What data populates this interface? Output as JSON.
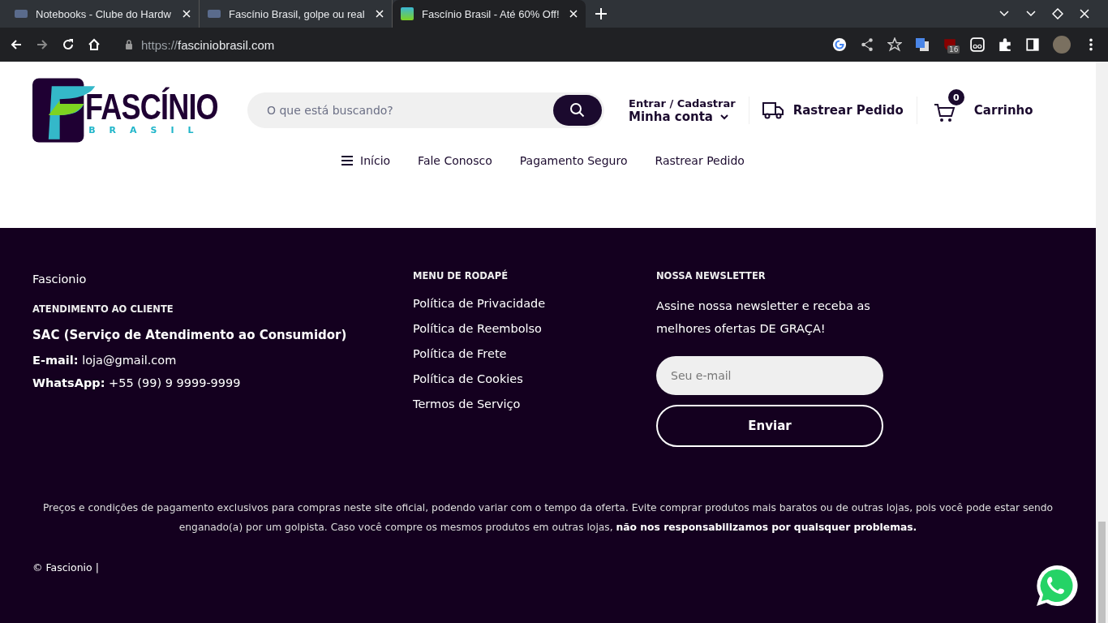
{
  "browser": {
    "tabs": [
      {
        "title": "Notebooks - Clube do Hardw",
        "selected": false
      },
      {
        "title": "Fascínio Brasil, golpe ou real",
        "selected": false
      },
      {
        "title": "Fascínio Brasil - Até 60% Off!",
        "selected": true
      }
    ],
    "url": {
      "scheme": "https://",
      "host": "fasciniobrasil.com"
    },
    "extension_badge": "16"
  },
  "header": {
    "logo": {
      "name": "FASCÍNIO",
      "sub": "BRASIL"
    },
    "search": {
      "placeholder": "O que está buscando?"
    },
    "account": {
      "top": "Entrar / Cadastrar",
      "bottom": "Minha conta"
    },
    "track": "Rastrear Pedido",
    "cart": {
      "count": "0",
      "label": "Carrinho"
    },
    "nav": [
      {
        "label": "Início",
        "kind": "menu"
      },
      {
        "label": "Fale Conosco",
        "kind": "link"
      },
      {
        "label": "Pagamento Seguro",
        "kind": "link"
      },
      {
        "label": "Rastrear Pedido",
        "kind": "link"
      }
    ]
  },
  "footer": {
    "brand": "Fascionio",
    "support_heading": "ATENDIMENTO AO CLIENTE",
    "sac": "SAC (Serviço de Atendimento ao Consumidor)",
    "contacts": [
      {
        "label": "E-mail:",
        "value": "loja@gmail.com"
      },
      {
        "label": "WhatsApp:",
        "value": "+55 (99) 9 9999-9999"
      }
    ],
    "menu_heading": "MENU DE RODAPÉ",
    "links": [
      "Política de Privacidade",
      "Política de Reembolso",
      "Política de Frete",
      "Política de Cookies",
      "Termos de Serviço"
    ],
    "newsletter_heading": "NOSSA NEWSLETTER",
    "newsletter_text": "Assine nossa newsletter e receba as melhores ofertas DE GRAÇA!",
    "email_placeholder": "Seu e-mail",
    "submit": "Enviar",
    "disclaimer": "Preços e condições de pagamento exclusivos para compras neste site oficial, podendo variar com o tempo da oferta. Evite comprar produtos mais baratos ou de outras lojas, pois você pode estar sendo enganado(a) por um golpista. Caso você compre os mesmos produtos em outras lojas, **não nos responsabilizamos por quaisquer problemas.**",
    "copyright": "© Fascionio |"
  }
}
